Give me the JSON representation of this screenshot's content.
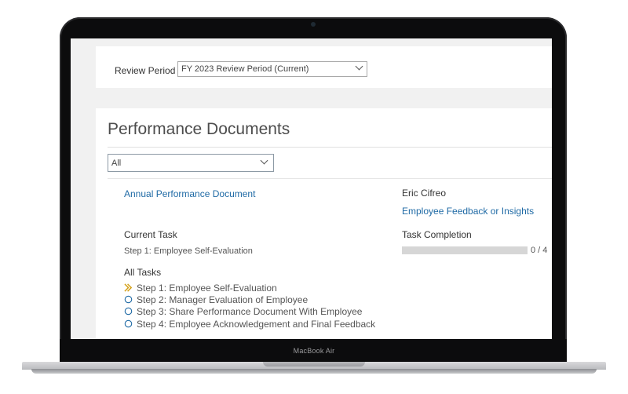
{
  "device": {
    "model_label": "MacBook Air"
  },
  "review_period": {
    "label": "Review Period",
    "selected": "FY 2023 Review Period (Current)"
  },
  "performance_documents": {
    "title": "Performance Documents",
    "filter_selected": "All"
  },
  "document": {
    "link": "Annual Performance Document",
    "employee_name": "Eric Cifreo",
    "feedback_link": "Employee Feedback or Insights",
    "current_task_heading": "Current Task",
    "current_task_value": "Step 1: Employee Self-Evaluation",
    "task_completion_heading": "Task Completion",
    "task_completion_text": "0 / 4",
    "task_completion_fraction": 0,
    "all_tasks_heading": "All Tasks",
    "tasks": [
      {
        "label": "Step 1: Employee Self-Evaluation",
        "icon": "current-step-chevron-icon"
      },
      {
        "label": "Step 2: Manager Evaluation of Employee",
        "icon": "circle-icon"
      },
      {
        "label": "Step 3: Share Performance Document With Employee",
        "icon": "circle-icon"
      },
      {
        "label": "Step 4: Employee Acknowledgement and Final Feedback",
        "icon": "circle-icon"
      }
    ]
  },
  "colors": {
    "link": "#1f6aa5",
    "current_step_icon": "#d4a017",
    "pending_step_icon": "#1f6aa5",
    "progress_track": "#d6d6d6"
  }
}
